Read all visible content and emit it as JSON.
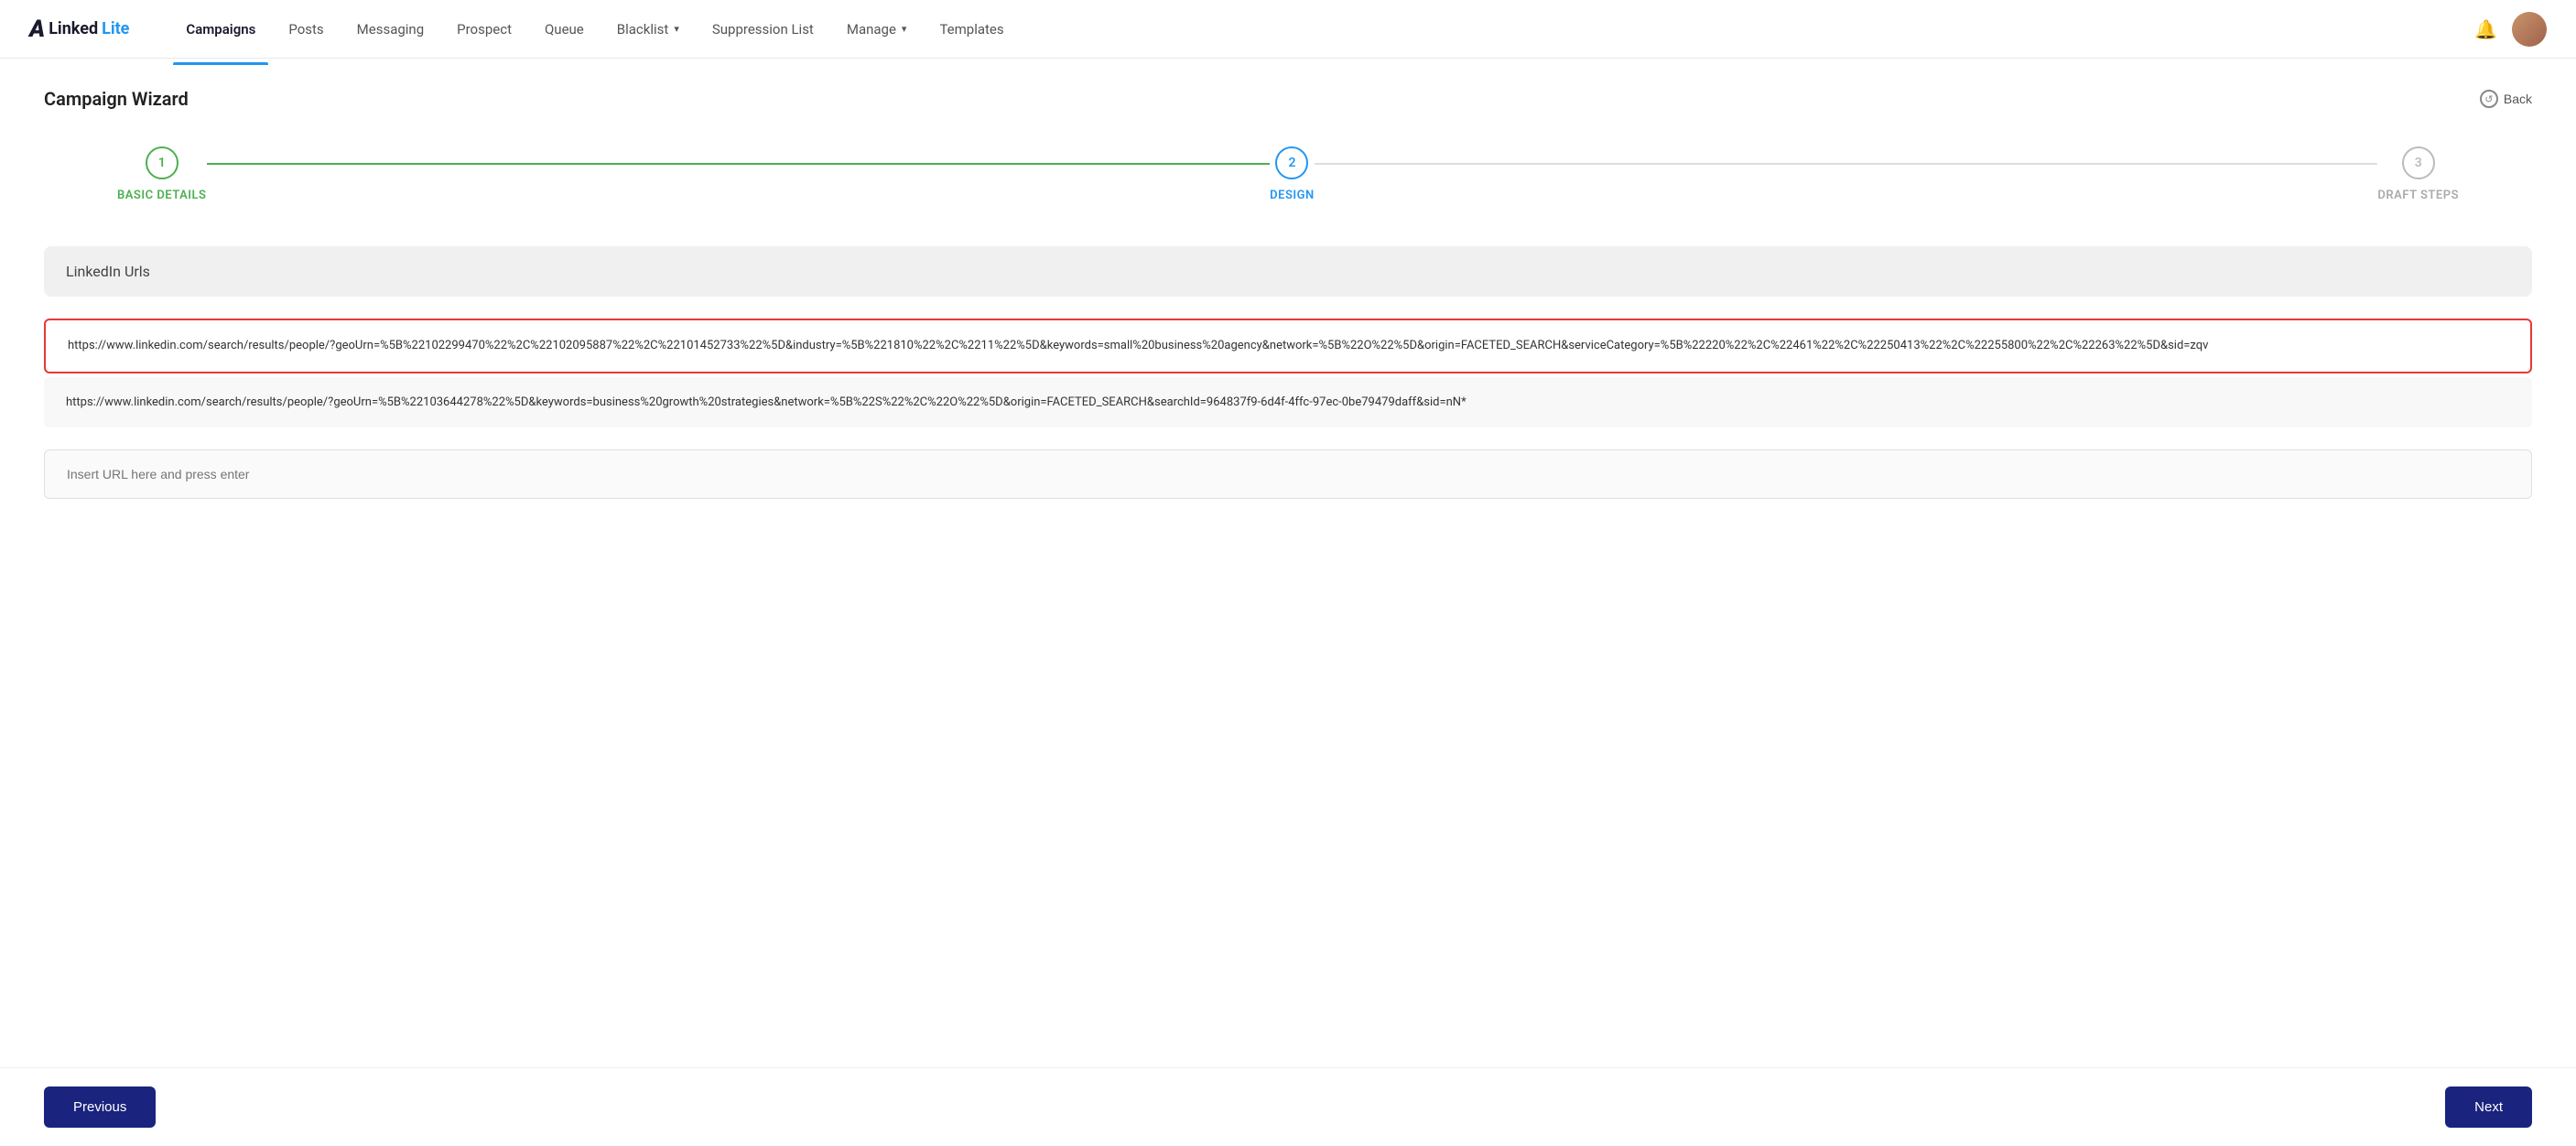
{
  "navbar": {
    "logo": "LinkedLite",
    "logo_a": "A",
    "logo_linked": "Linked",
    "logo_lite": "Lite",
    "links": [
      {
        "label": "Campaigns",
        "active": true
      },
      {
        "label": "Posts",
        "active": false
      },
      {
        "label": "Messaging",
        "active": false
      },
      {
        "label": "Prospect",
        "active": false
      },
      {
        "label": "Queue",
        "active": false
      },
      {
        "label": "Blacklist",
        "active": false,
        "dropdown": true
      },
      {
        "label": "Suppression List",
        "active": false
      },
      {
        "label": "Manage",
        "active": false,
        "dropdown": true
      },
      {
        "label": "Templates",
        "active": false
      }
    ],
    "bell_icon": "🔔",
    "back_label": "Back"
  },
  "page": {
    "title": "Campaign Wizard"
  },
  "wizard": {
    "steps": [
      {
        "number": "1",
        "label": "BASIC DETAILS",
        "state": "completed"
      },
      {
        "number": "2",
        "label": "DESIGN",
        "state": "active"
      },
      {
        "number": "3",
        "label": "DRAFT STEPS",
        "state": "inactive"
      }
    ]
  },
  "section": {
    "header": "LinkedIn Urls"
  },
  "urls": {
    "url1": "https://www.linkedin.com/search/results/people/?geoUrn=%5B%22102299470%22%2C%22102095887%22%2C%22101452733%22%5D&industry=%5B%221810%22%2C%2211%22%5D&keywords=small%20business%20agency&network=%5B%22O%22%5D&origin=FACETED_SEARCH&serviceCategory=%5B%22220%22%2C%22461%22%2C%22250413%22%2C%22255800%22%2C%22263%22%5D&sid=zqv",
    "url2": "https://www.linkedin.com/search/results/people/?geoUrn=%5B%22103644278%22%5D&keywords=business%20growth%20strategies&network=%5B%22S%22%2C%22O%22%5D&origin=FACETED_SEARCH&searchId=964837f9-6d4f-4ffc-97ec-0be79479daff&sid=nN*",
    "input_placeholder": "Insert URL here and press enter"
  },
  "buttons": {
    "previous": "Previous",
    "next": "Next"
  }
}
